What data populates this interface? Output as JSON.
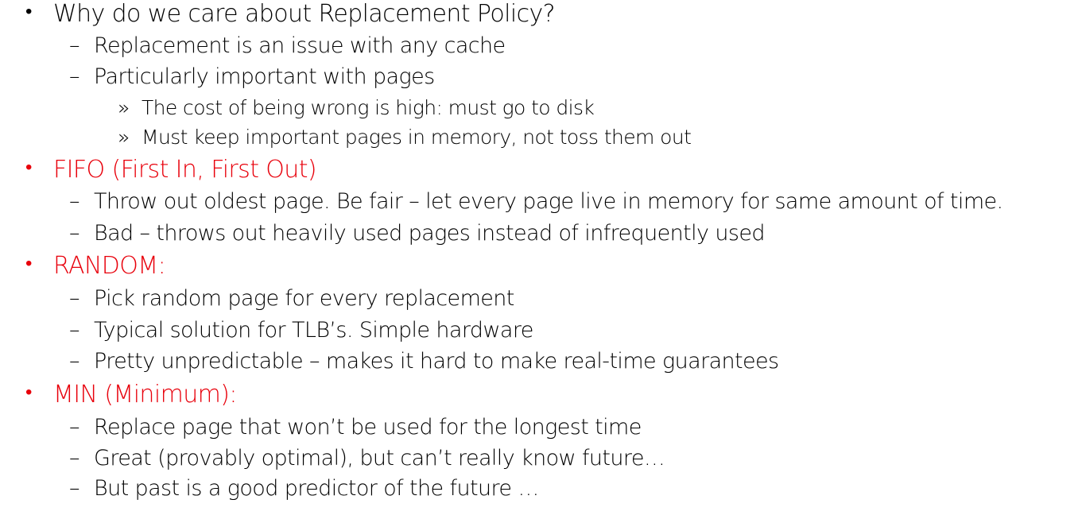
{
  "colors": {
    "text": "#000000",
    "heading_red": "#e8000b",
    "background": "#ffffff"
  },
  "markers": {
    "bullet": "•",
    "dash": "–",
    "raquo": "»"
  },
  "sections": [
    {
      "heading": "Why do we care about Replacement Policy?",
      "items": [
        {
          "text": "Replacement is an issue with any cache"
        },
        {
          "text": "Particularly important with pages",
          "subitems": [
            "The cost of being wrong is high: must go to disk",
            "Must keep important pages in memory, not toss them out"
          ]
        }
      ]
    },
    {
      "heading": "FIFO (First In, First Out)",
      "items": [
        {
          "text": "Throw out oldest page.  Be fair – let every page live in memory for same amount of time."
        },
        {
          "text": "Bad – throws out heavily used pages instead of infrequently used"
        }
      ]
    },
    {
      "heading": "RANDOM:",
      "items": [
        {
          "text": "Pick random page for every replacement"
        },
        {
          "text": "Typical solution for TLB’s.  Simple hardware"
        },
        {
          "text": "Pretty unpredictable – makes it hard to make real-time guarantees"
        }
      ]
    },
    {
      "heading": "MIN (Minimum):",
      "items": [
        {
          "text": "Replace page that won’t be used for the longest time"
        },
        {
          "text": "Great (provably optimal), but can’t really know future…"
        },
        {
          "text": "But past is a good predictor of the future …"
        }
      ]
    }
  ]
}
